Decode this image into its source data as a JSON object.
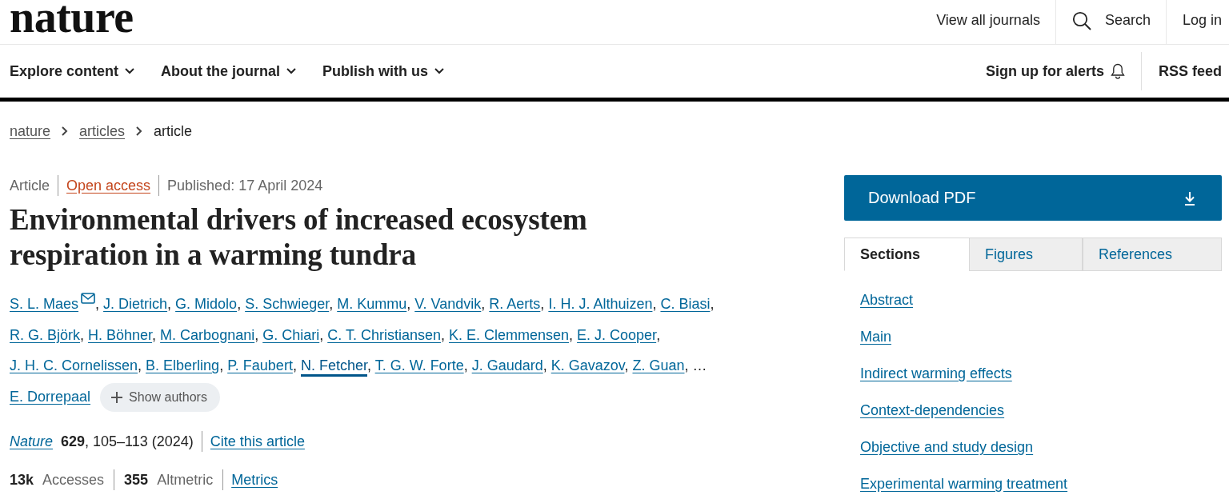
{
  "header": {
    "logo": "nature",
    "top_links": [
      {
        "kind": "text",
        "label": "View all journals"
      },
      {
        "kind": "search",
        "label": "Search"
      },
      {
        "kind": "text",
        "label": "Log in"
      }
    ],
    "nav": [
      {
        "label": "Explore content",
        "dropdown": true
      },
      {
        "label": "About the journal",
        "dropdown": true
      },
      {
        "label": "Publish with us",
        "dropdown": true
      }
    ],
    "alerts": "Sign up for alerts",
    "rss": "RSS feed"
  },
  "breadcrumb": [
    {
      "label": "nature",
      "link": true
    },
    {
      "label": "articles",
      "link": true
    },
    {
      "label": "article",
      "link": false
    }
  ],
  "article": {
    "meta": [
      {
        "kind": "type",
        "text": "Article"
      },
      {
        "kind": "access",
        "text": "Open access"
      },
      {
        "kind": "date",
        "text": "Published: 17 April 2024"
      }
    ],
    "title": "Environmental drivers of increased ecosystem respiration in a warming tundra",
    "authors": {
      "separator": ",",
      "listed": [
        {
          "name": "S. L. Maes",
          "contact": true,
          "highlighted": false
        },
        {
          "name": "J. Dietrich",
          "contact": false,
          "highlighted": false
        },
        {
          "name": "G. Midolo",
          "contact": false,
          "highlighted": false
        },
        {
          "name": "S. Schwieger",
          "contact": false,
          "highlighted": false
        },
        {
          "name": "M. Kummu",
          "contact": false,
          "highlighted": false
        },
        {
          "name": "V. Vandvik",
          "contact": false,
          "highlighted": false
        },
        {
          "name": "R. Aerts",
          "contact": false,
          "highlighted": false
        },
        {
          "name": "I. H. J. Althuizen",
          "contact": false,
          "highlighted": false
        },
        {
          "name": "C. Biasi",
          "contact": false,
          "highlighted": false
        },
        {
          "name": "R. G. Björk",
          "contact": false,
          "highlighted": false
        },
        {
          "name": "H. Böhner",
          "contact": false,
          "highlighted": false
        },
        {
          "name": "M. Carbognani",
          "contact": false,
          "highlighted": false
        },
        {
          "name": "G. Chiari",
          "contact": false,
          "highlighted": false
        },
        {
          "name": "C. T. Christiansen",
          "contact": false,
          "highlighted": false
        },
        {
          "name": "K. E. Clemmensen",
          "contact": false,
          "highlighted": false
        },
        {
          "name": "E. J. Cooper",
          "contact": false,
          "highlighted": false
        },
        {
          "name": "J. H. C. Cornelissen",
          "contact": false,
          "highlighted": false
        },
        {
          "name": "B. Elberling",
          "contact": false,
          "highlighted": false
        },
        {
          "name": "P. Faubert",
          "contact": false,
          "highlighted": false
        },
        {
          "name": "N. Fetcher",
          "contact": false,
          "highlighted": true
        },
        {
          "name": "T. G. W. Forte",
          "contact": false,
          "highlighted": false
        },
        {
          "name": "J. Gaudard",
          "contact": false,
          "highlighted": false
        },
        {
          "name": "K. Gavazov",
          "contact": false,
          "highlighted": false
        },
        {
          "name": "Z. Guan",
          "contact": false,
          "highlighted": false
        }
      ],
      "ellipsis": "…",
      "last": {
        "name": "E. Dorrepaal",
        "contact": false,
        "highlighted": false
      },
      "show_all": "Show authors"
    },
    "citation": {
      "journal": "Nature",
      "details": "**629**, 105–113 (2024)",
      "cite_link": "Cite this article"
    },
    "metrics": [
      {
        "text": "**13k** Accesses"
      },
      {
        "text": "**355** Altmetric"
      }
    ],
    "metrics_link": "Metrics"
  },
  "sidebar": {
    "download": "Download PDF",
    "tabs": [
      {
        "label": "Sections",
        "selected": true
      },
      {
        "label": "Figures",
        "selected": false
      },
      {
        "label": "References",
        "selected": false
      }
    ],
    "sections": [
      "Abstract",
      "Main",
      "Indirect warming effects",
      "Context-dependencies",
      "Objective and study design",
      "Experimental warming treatment"
    ]
  }
}
